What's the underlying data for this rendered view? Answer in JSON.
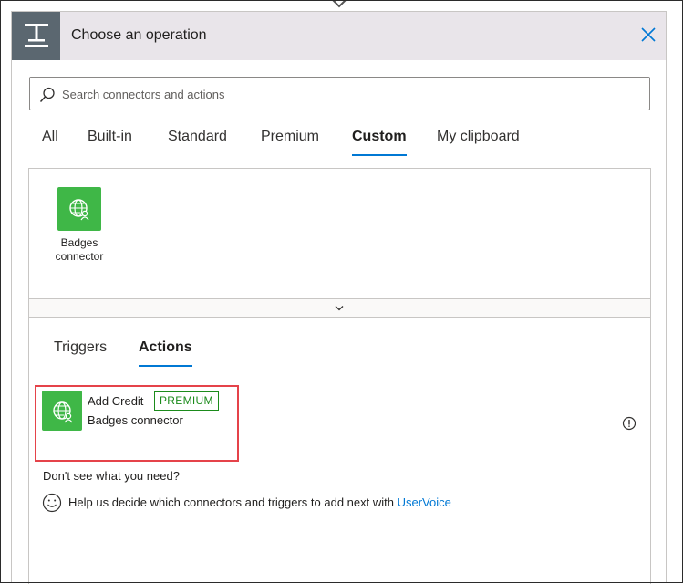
{
  "header": {
    "title": "Choose an operation",
    "icon": "operation-icon",
    "close_icon": "close-icon"
  },
  "search": {
    "placeholder": "Search connectors and actions",
    "value": ""
  },
  "tabs": [
    {
      "label": "All",
      "active": false
    },
    {
      "label": "Built-in",
      "active": false
    },
    {
      "label": "Standard",
      "active": false
    },
    {
      "label": "Premium",
      "active": false
    },
    {
      "label": "Custom",
      "active": true
    },
    {
      "label": "My clipboard",
      "active": false
    }
  ],
  "connectors": [
    {
      "label": "Badges connector",
      "icon": "globe-user-icon"
    }
  ],
  "subtabs": [
    {
      "label": "Triggers",
      "active": false
    },
    {
      "label": "Actions",
      "active": true
    }
  ],
  "actions": [
    {
      "title": "Add Credit",
      "badge": "PREMIUM",
      "connector": "Badges connector"
    }
  ],
  "help": {
    "title": "Don't see what you need?",
    "text": "Help us decide which connectors and triggers to add next with",
    "link": "UserVoice"
  },
  "colors": {
    "accent": "#0078d4",
    "connector_green": "#3fb747",
    "premium_green": "#1b8b1b",
    "highlight_red": "#e5434a"
  }
}
